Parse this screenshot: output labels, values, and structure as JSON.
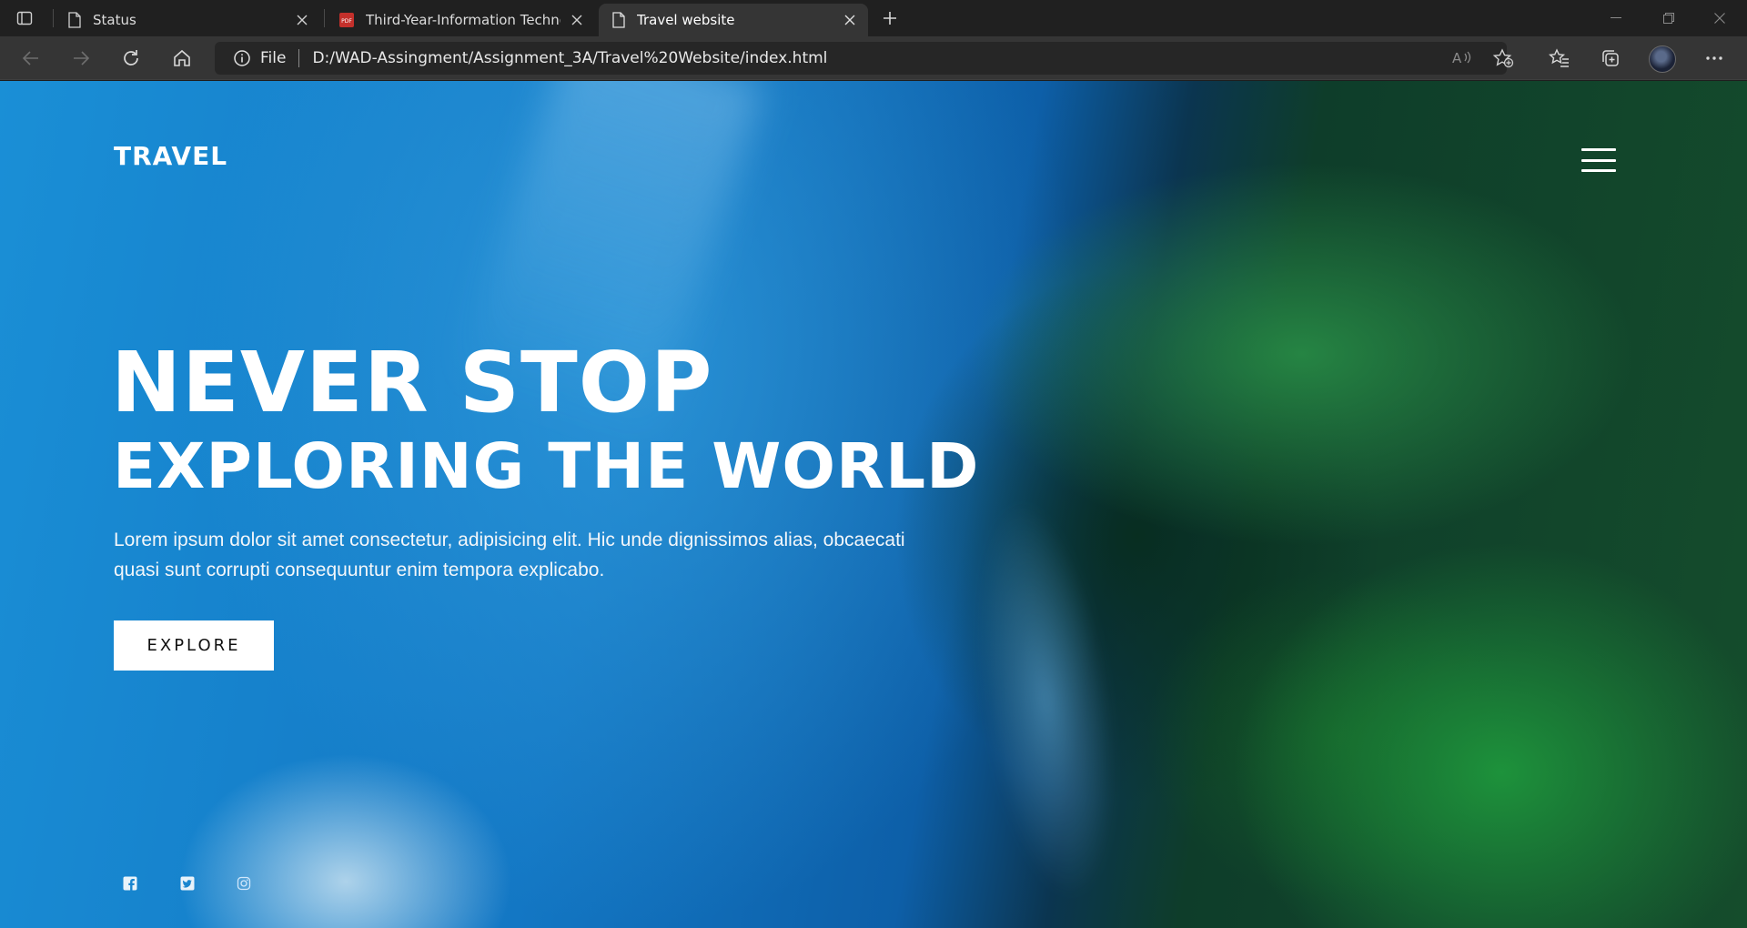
{
  "browser": {
    "tabs": [
      {
        "title": "Status",
        "icon": "page-icon"
      },
      {
        "title": "Third-Year-Information Technolo",
        "icon": "pdf-icon"
      },
      {
        "title": "Travel website",
        "icon": "page-icon",
        "active": true
      }
    ],
    "address": {
      "scheme_label": "File",
      "url": "D:/WAD-Assingment/Assignment_3A/Travel%20Website/index.html"
    }
  },
  "page": {
    "brand": "TRAVEL",
    "hero": {
      "line1": "NEVER STOP",
      "line2": "EXPLORING THE WORLD",
      "text": "Lorem ipsum dolor sit amet consectetur, adipisicing elit. Hic unde dignissimos alias, obcaecati quasi sunt corrupti consequuntur enim tempora explicabo.",
      "cta": "EXPLORE"
    },
    "social": [
      "facebook-icon",
      "twitter-icon",
      "instagram-icon"
    ]
  }
}
